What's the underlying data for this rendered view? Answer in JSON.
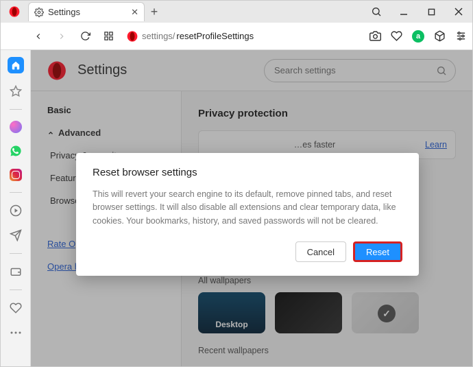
{
  "window": {
    "tab_title": "Settings"
  },
  "address": {
    "scheme_icon": "opera",
    "prefix": "settings/",
    "path": "resetProfileSettings"
  },
  "settings": {
    "page_title": "Settings",
    "search_placeholder": "Search settings",
    "nav": {
      "basic": "Basic",
      "advanced": "Advanced",
      "items": [
        "Privacy & security",
        "Features",
        "Browser"
      ],
      "rate": "Rate Opera",
      "help": "Opera help"
    },
    "privacy_section": "Privacy protection",
    "ad_text": "…es faster",
    "learn": "Learn",
    "wallpapers_label": "All wallpapers",
    "wp_desktop": "Desktop",
    "recent_label": "Recent wallpapers"
  },
  "modal": {
    "title": "Reset browser settings",
    "body": "This will revert your search engine to its default, remove pinned tabs, and reset browser settings. It will also disable all extensions and clear temporary data, like cookies. Your bookmarks, history, and saved passwords will not be cleared.",
    "cancel": "Cancel",
    "reset": "Reset"
  }
}
